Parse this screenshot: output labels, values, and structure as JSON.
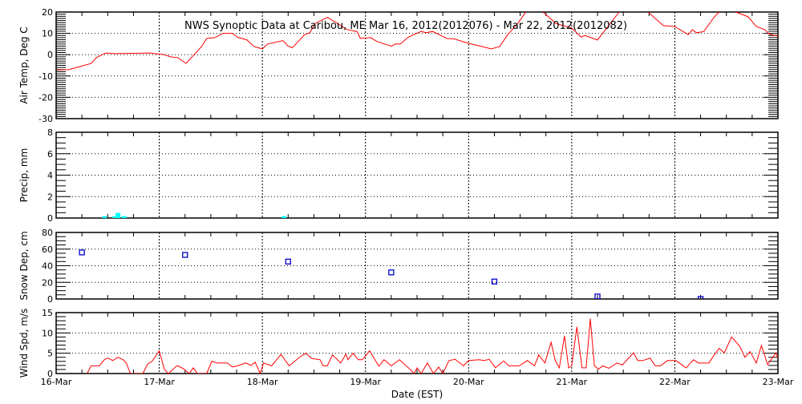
{
  "chart_data": [
    {
      "type": "line",
      "title": "NWS Synoptic Data at Caribou, ME   Mar 16, 2012(2012076) - Mar 22, 2012(2012082)",
      "ylabel": "Air Temp, Deg C",
      "ylim": [
        -30,
        20
      ],
      "yticks": [
        -30,
        -20,
        -10,
        0,
        10,
        20
      ],
      "color": "#ff0000",
      "x_days": [
        0.01,
        0.12,
        0.23,
        0.34,
        0.39,
        0.48,
        0.57,
        0.91,
        1.05,
        1.11,
        1.18,
        1.26,
        1.41,
        1.46,
        1.54,
        1.62,
        1.71,
        1.76,
        1.85,
        1.92,
        2.0,
        2.05,
        2.2,
        2.25,
        2.29,
        2.41,
        2.46,
        2.51,
        2.63,
        2.72,
        2.82,
        2.92,
        2.95,
        3.05,
        3.11,
        3.25,
        3.29,
        3.34,
        3.41,
        3.54,
        3.59,
        3.65,
        3.79,
        3.86,
        4.0,
        4.09,
        4.22,
        4.3,
        4.38,
        4.48,
        4.6,
        4.72,
        4.85,
        5.0,
        5.09,
        5.13,
        5.25,
        5.34,
        5.46,
        5.6,
        5.74,
        5.89,
        6.0,
        6.13,
        6.17,
        6.21,
        6.28,
        6.38,
        6.43,
        6.5,
        6.59,
        6.71,
        6.79,
        6.87,
        6.92,
        7.0
      ],
      "values": [
        -7.2,
        -7,
        -5.6,
        -4.1,
        -1.4,
        0.8,
        0.5,
        0.8,
        0,
        -1,
        -1.4,
        -4.1,
        3.8,
        7.6,
        8,
        10,
        10,
        8.2,
        6.9,
        3.8,
        2.7,
        5,
        6.6,
        4,
        3.2,
        9.4,
        10.3,
        14.6,
        17.5,
        14.9,
        11.8,
        10.8,
        7.6,
        8,
        6.2,
        4,
        5,
        5,
        8.1,
        10.9,
        10.3,
        10.9,
        7.6,
        7.4,
        5.3,
        4.3,
        2.7,
        3.8,
        9.4,
        14.9,
        23,
        20,
        14.6,
        12.5,
        8.3,
        9,
        6.9,
        12.5,
        20,
        23,
        20,
        13.6,
        13.2,
        9.4,
        11.7,
        10.3,
        10.8,
        17.5,
        20,
        22,
        20,
        17.8,
        13.2,
        11.8,
        9.6,
        8.7
      ]
    },
    {
      "type": "bar",
      "ylabel": "Precip, mm",
      "ylim": [
        0,
        8
      ],
      "yticks": [
        0,
        2,
        4,
        6,
        8
      ],
      "color": "#00ffff",
      "x_days": [
        0.47,
        0.57,
        0.6,
        0.66,
        2.21
      ],
      "values": [
        0.1,
        0.1,
        0.4,
        0.1,
        0.1
      ]
    },
    {
      "type": "scatter",
      "ylabel": "Snow Dep, cm",
      "ylim": [
        0,
        80
      ],
      "yticks": [
        0,
        20,
        40,
        60,
        80
      ],
      "color": "#0000cc",
      "x_days": [
        0.25,
        1.25,
        2.25,
        3.25,
        4.25,
        5.25,
        6.25
      ],
      "values": [
        56,
        53,
        45,
        32,
        21,
        3,
        0
      ]
    },
    {
      "type": "line",
      "ylabel": "Wind Spd, m/s",
      "ylim": [
        0,
        15
      ],
      "yticks": [
        0,
        5,
        10,
        15
      ],
      "color": "#ff0000",
      "x_days": [
        0.3,
        0.34,
        0.42,
        0.47,
        0.5,
        0.55,
        0.6,
        0.65,
        0.68,
        0.72,
        0.76,
        0.84,
        0.89,
        0.93,
        1.0,
        1.05,
        1.09,
        1.17,
        1.19,
        1.24,
        1.29,
        1.33,
        1.37,
        1.46,
        1.51,
        1.56,
        1.66,
        1.71,
        1.76,
        1.84,
        1.89,
        1.93,
        1.98,
        2.01,
        2.09,
        2.18,
        2.26,
        2.36,
        2.42,
        2.48,
        2.56,
        2.59,
        2.63,
        2.68,
        2.76,
        2.81,
        2.83,
        2.88,
        2.93,
        2.97,
        3.04,
        3.13,
        3.18,
        3.25,
        3.33,
        3.43,
        3.47,
        3.5,
        3.54,
        3.6,
        3.66,
        3.71,
        3.75,
        3.81,
        3.87,
        3.95,
        4.0,
        4.1,
        4.15,
        4.2,
        4.26,
        4.34,
        4.39,
        4.49,
        4.57,
        4.64,
        4.68,
        4.74,
        4.8,
        4.84,
        4.88,
        4.93,
        4.97,
        5.0,
        5.05,
        5.1,
        5.14,
        5.18,
        5.22,
        5.26,
        5.3,
        5.36,
        5.44,
        5.49,
        5.6,
        5.64,
        5.69,
        5.76,
        5.81,
        5.86,
        5.93,
        6.01,
        6.11,
        6.18,
        6.23,
        6.33,
        6.38,
        6.43,
        6.48,
        6.55,
        6.63,
        6.68,
        6.73,
        6.79,
        6.84,
        6.9,
        6.98,
        7.0
      ],
      "values": [
        0,
        1.9,
        1.9,
        3.5,
        3.8,
        3.2,
        4,
        3.4,
        2.6,
        0,
        0,
        0,
        2.4,
        3,
        5.6,
        1,
        0,
        1.9,
        1.8,
        1.1,
        0,
        1.4,
        0,
        0,
        3,
        2.6,
        2.6,
        1.6,
        1.9,
        2.6,
        2,
        2.8,
        0,
        2.6,
        1.9,
        4.7,
        1.9,
        4,
        5,
        3.7,
        3.4,
        1.9,
        1.9,
        4.6,
        2.6,
        4.8,
        3.4,
        5,
        3.4,
        3.4,
        5.6,
        1.8,
        3.4,
        1.9,
        3.4,
        1.1,
        0,
        1.4,
        0,
        2.6,
        0,
        1.6,
        0,
        3.2,
        3.5,
        1.9,
        3.2,
        3.4,
        3.2,
        3.5,
        1.4,
        3.1,
        1.9,
        1.9,
        3.2,
        1.9,
        4.6,
        2.6,
        7.7,
        3.2,
        1.4,
        9.3,
        1.4,
        1.9,
        11.5,
        1.4,
        1.4,
        13.5,
        1.9,
        1.1,
        1.9,
        1.3,
        2.6,
        2.1,
        5.1,
        3.2,
        3.2,
        3.8,
        1.9,
        1.9,
        3.2,
        3.2,
        1.4,
        3.4,
        2.6,
        2.6,
        4.5,
        6.2,
        5.1,
        9,
        6.7,
        4,
        5.4,
        2.6,
        6.9,
        2.2,
        5.1,
        3.8
      ]
    }
  ],
  "x_axis": {
    "xlabel": "Date (EST)",
    "ticks": [
      "16-Mar",
      "17-Mar",
      "18-Mar",
      "19-Mar",
      "20-Mar",
      "21-Mar",
      "22-Mar",
      "23-Mar"
    ]
  }
}
